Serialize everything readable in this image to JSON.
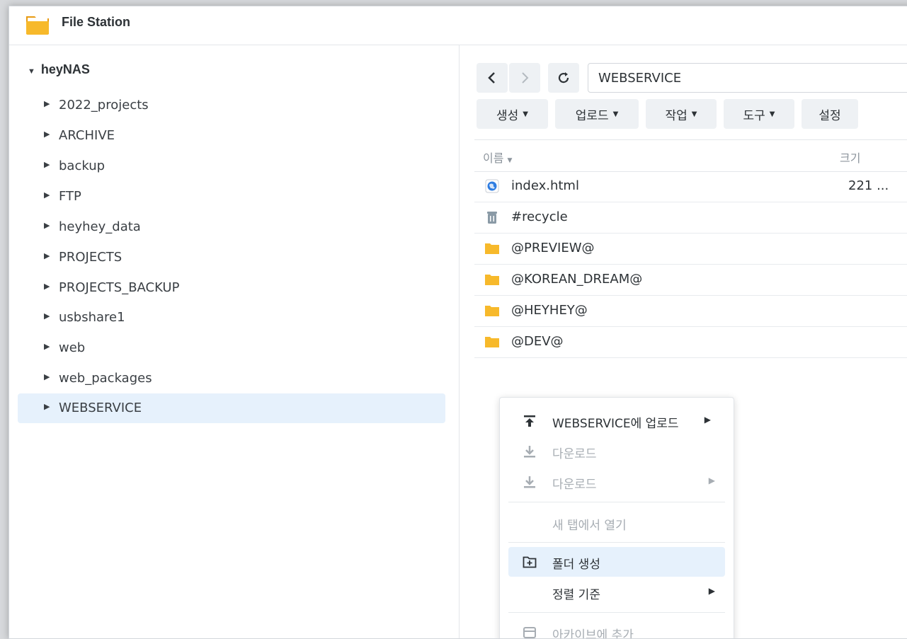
{
  "app": {
    "title": "File Station"
  },
  "tree": {
    "root": "heyNAS",
    "items": [
      {
        "label": "2022_projects"
      },
      {
        "label": "ARCHIVE"
      },
      {
        "label": "backup"
      },
      {
        "label": "FTP"
      },
      {
        "label": "heyhey_data"
      },
      {
        "label": "PROJECTS"
      },
      {
        "label": "PROJECTS_BACKUP"
      },
      {
        "label": "usbshare1"
      },
      {
        "label": "web"
      },
      {
        "label": "web_packages"
      },
      {
        "label": "WEBSERVICE",
        "selected": true
      }
    ]
  },
  "toolbar": {
    "path": "WEBSERVICE",
    "back_icon": "chevron-left-icon",
    "forward_icon": "chevron-right-icon",
    "refresh_icon": "refresh-icon",
    "create": "생성",
    "upload": "업로드",
    "action": "작업",
    "tools": "도구",
    "settings": "설정"
  },
  "columns": {
    "name": "이름",
    "size": "크기"
  },
  "files": [
    {
      "name": "index.html",
      "size": "221 ...",
      "icon": "web-file-icon"
    },
    {
      "name": "#recycle",
      "size": "",
      "icon": "trash-icon"
    },
    {
      "name": "@PREVIEW@",
      "size": "",
      "icon": "folder-icon"
    },
    {
      "name": "@KOREAN_DREAM@",
      "size": "",
      "icon": "folder-icon"
    },
    {
      "name": "@HEYHEY@",
      "size": "",
      "icon": "folder-icon"
    },
    {
      "name": "@DEV@",
      "size": "",
      "icon": "folder-icon"
    }
  ],
  "context_menu": {
    "upload_to": "WEBSERVICE에 업로드",
    "download": "다운로드",
    "download_sub": "다운로드",
    "open_new_tab": "새 탭에서 열기",
    "create_folder": "폴더 생성",
    "sort_by": "정렬 기준",
    "add_to_archive": "아카이브에 추가"
  },
  "colors": {
    "selected_bg": "#e6f1fc",
    "folder": "#f7b92b",
    "accent": "#2f7de1"
  }
}
